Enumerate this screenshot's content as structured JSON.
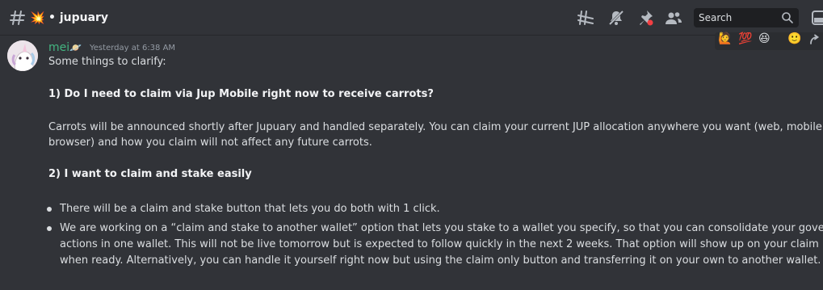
{
  "header": {
    "channel_emoji": "💥",
    "channel_name": "• jupuary",
    "search_placeholder": "Search",
    "icons": [
      "hashtag-slash-icon",
      "threads-icon",
      "notification-muted-icon",
      "pin-icon",
      "members-icon",
      "search-icon",
      "inbox-icon"
    ]
  },
  "reactions": [
    "🙋",
    "💯",
    "😆",
    "🙂"
  ],
  "message": {
    "author": "mei",
    "author_emoji": "🪐",
    "timestamp": "Yesterday at 6:38 AM",
    "intro": "Some things to clarify:",
    "q1": "1) Do I need to claim via Jup Mobile right now to receive carrots?",
    "a1_line1": "Carrots will be announced shortly after Jupuary and handled separately. You can claim your current JUP allocation anywhere you want (web, mobile",
    "a1_line2": "browser) and how you claim will not affect any future carrots.",
    "q2": "2) I want to claim and stake easily",
    "bullet1": "There will be a claim and stake button that lets you do both with 1 click.",
    "bullet2_line1": "We are working on a “claim and stake to another wallet” option that lets you stake to a wallet you specify, so that you can consolidate your governance",
    "bullet2_line2": "actions in one wallet. This will not be live tomorrow but is expected to follow quickly in the next 2 weeks. That option will show up on your claim modal",
    "bullet2_line3": "when ready. Alternatively, you can handle it yourself right now but using the claim only button and transferring it on your own to another wallet."
  }
}
